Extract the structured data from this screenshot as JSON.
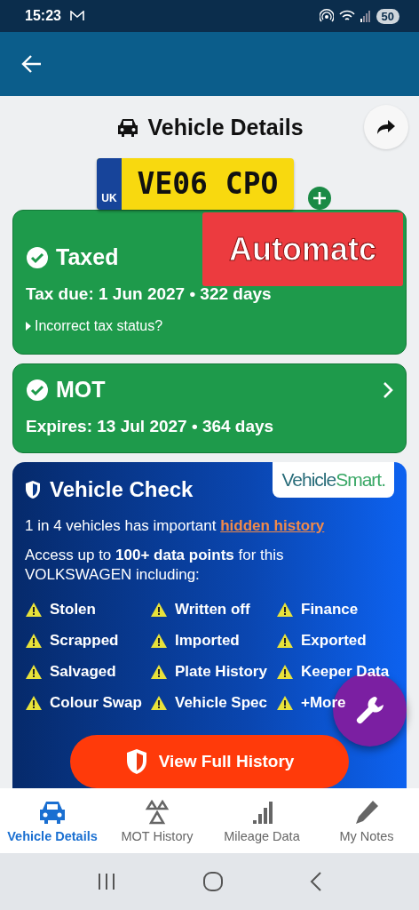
{
  "status_bar": {
    "time": "15:23",
    "battery": "50"
  },
  "header": {
    "title": "Vehicle Details"
  },
  "plate": {
    "country": "UK",
    "number": "VE06 CPO"
  },
  "status_cards": [
    {
      "title": "Taxed",
      "ok": true,
      "detail": "Tax due: 1 Jun 2027 • 322 days",
      "link": "Incorrect tax status?"
    },
    {
      "title": "MOT",
      "ok": true,
      "detail": "Expires: 13 Jul 2027 • 364 days"
    }
  ],
  "overlay_label": "Automatc",
  "vehicle_check": {
    "title": "Vehicle Check",
    "brand_first": "Vehicle",
    "brand_second": "Smart.",
    "intro": "1 in 4 vehicles has important",
    "intro_link": "hidden history",
    "access": "Access up to **100+ data points** for this VOLKSWAGEN including:",
    "items": [
      "Stolen",
      "Written off",
      "Finance",
      "Scrapped",
      "Imported",
      "Exported",
      "Salvaged",
      "Plate History",
      "Keeper Data",
      "Colour Swap",
      "Vehicle Spec",
      "+More"
    ],
    "button": "View Full History"
  },
  "bottom_nav": [
    {
      "label": "Vehicle Details",
      "selected": true
    },
    {
      "label": "MOT History",
      "selected": false
    },
    {
      "label": "Mileage Data",
      "selected": false
    },
    {
      "label": "My Notes",
      "selected": false
    }
  ]
}
